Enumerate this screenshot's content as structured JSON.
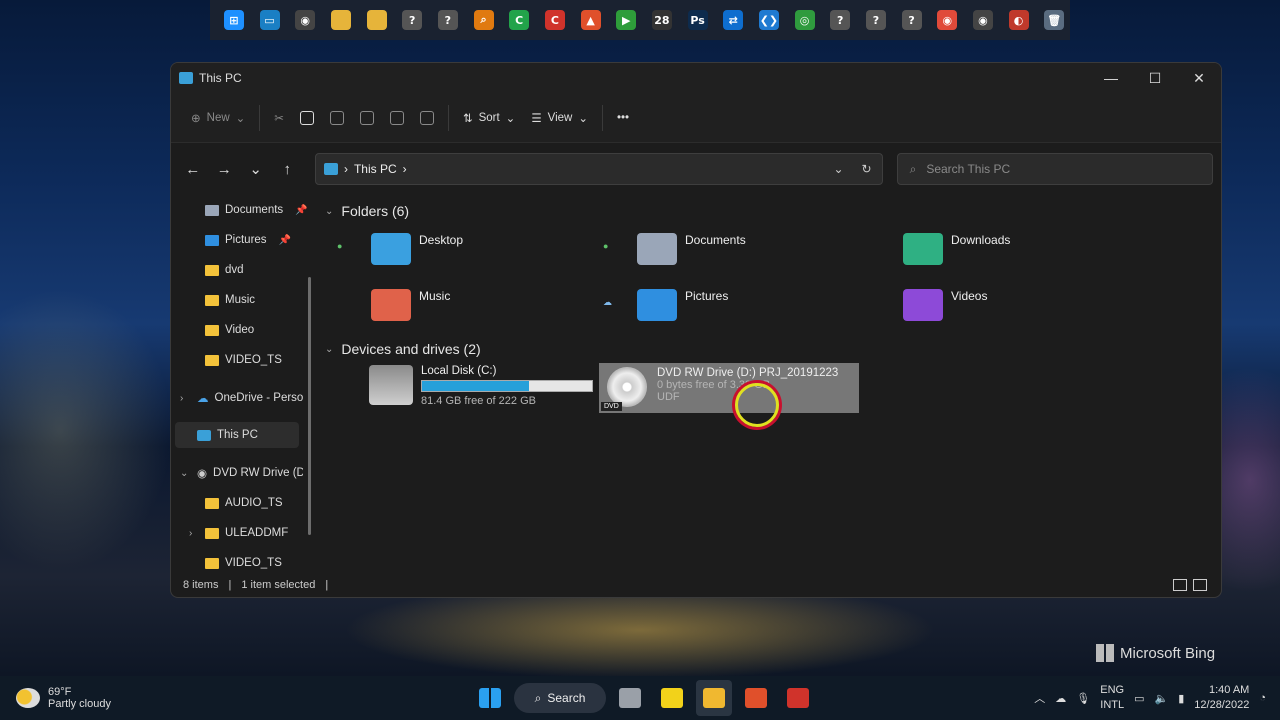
{
  "quick_launch": {
    "icons": [
      {
        "name": "windows-icon",
        "color": "#1e90ff",
        "glyph": "⊞"
      },
      {
        "name": "monitor-icon",
        "color": "#1a7fc4",
        "glyph": "▭"
      },
      {
        "name": "disc-app-icon",
        "color": "#444",
        "glyph": "◉"
      },
      {
        "name": "folder-icon",
        "color": "#e6b43a",
        "glyph": ""
      },
      {
        "name": "folder-icon",
        "color": "#e6b43a",
        "glyph": ""
      },
      {
        "name": "help-icon",
        "color": "#555",
        "glyph": "?"
      },
      {
        "name": "help-icon",
        "color": "#555",
        "glyph": "?"
      },
      {
        "name": "search-app-icon",
        "color": "#e07a10",
        "glyph": "⌕"
      },
      {
        "name": "camtasia-green-icon",
        "color": "#22a34a",
        "glyph": "C"
      },
      {
        "name": "camtasia-red-icon",
        "color": "#d0332b",
        "glyph": "C"
      },
      {
        "name": "brave-icon",
        "color": "#e0502b",
        "glyph": "▲"
      },
      {
        "name": "video-editor-icon",
        "color": "#2e9d3a",
        "glyph": "▶"
      },
      {
        "name": "calendar-icon",
        "color": "#333",
        "glyph": "28"
      },
      {
        "name": "photoshop-icon",
        "color": "#0d2b4d",
        "glyph": "Ps"
      },
      {
        "name": "teamviewer-icon",
        "color": "#0e6ecf",
        "glyph": "⇄"
      },
      {
        "name": "vscode-icon",
        "color": "#1f7ad1",
        "glyph": "❮❯"
      },
      {
        "name": "network-icon",
        "color": "#2f9b3e",
        "glyph": "◎"
      },
      {
        "name": "help-icon",
        "color": "#555",
        "glyph": "?"
      },
      {
        "name": "help-icon",
        "color": "#555",
        "glyph": "?"
      },
      {
        "name": "help-icon",
        "color": "#555",
        "glyph": "?"
      },
      {
        "name": "chrome-icon",
        "color": "#e04a3a",
        "glyph": "◉"
      },
      {
        "name": "disc-app-icon",
        "color": "#444",
        "glyph": "◉"
      },
      {
        "name": "burner-icon",
        "color": "#c0392b",
        "glyph": "◐"
      },
      {
        "name": "recycle-bin-icon",
        "color": "#5a6c80",
        "glyph": "🗑"
      }
    ]
  },
  "window": {
    "title": "This PC",
    "minimize": "—",
    "maximize": "☐",
    "close": "✕"
  },
  "toolbar": {
    "new": "New",
    "sort": "Sort",
    "view": "View",
    "more": "•••"
  },
  "address": {
    "location": "This PC",
    "separator": "›"
  },
  "search": {
    "placeholder": "Search This PC"
  },
  "sidebar": {
    "items": [
      {
        "label": "Documents",
        "pinned": true
      },
      {
        "label": "Pictures",
        "pinned": true
      },
      {
        "label": "dvd"
      },
      {
        "label": "Music"
      },
      {
        "label": "Video"
      },
      {
        "label": "VIDEO_TS"
      },
      {
        "label": "OneDrive - Perso"
      },
      {
        "label": "This PC"
      },
      {
        "label": "DVD RW Drive (D"
      },
      {
        "label": "AUDIO_TS"
      },
      {
        "label": "ULEADDMF"
      },
      {
        "label": "VIDEO_TS"
      }
    ]
  },
  "folders": {
    "header": "Folders (6)",
    "items": [
      {
        "label": "Desktop",
        "color": "#3aa0e0"
      },
      {
        "label": "Documents",
        "color": "#9aa6b8"
      },
      {
        "label": "Downloads",
        "color": "#2fb083"
      },
      {
        "label": "Music",
        "color": "#e0624a"
      },
      {
        "label": "Pictures",
        "color": "#2f8fe0"
      },
      {
        "label": "Videos",
        "color": "#8d4ad8"
      }
    ]
  },
  "drives": {
    "header": "Devices and drives (2)",
    "items": [
      {
        "label": "Local Disk (C:)",
        "free": "81.4 GB free of 222 GB",
        "used_fraction": 0.63
      },
      {
        "label": "DVD RW Drive (D:) PRJ_20191223",
        "free": "0 bytes free of 3.39 GB",
        "fs": "UDF",
        "badge": "DVD"
      }
    ]
  },
  "statusbar": {
    "count": "8 items",
    "selected": "1 item selected",
    "divider": "|"
  },
  "watermark": {
    "text": "Microsoft Bing"
  },
  "taskbar": {
    "search": "Search",
    "weather_temp": "69°F",
    "weather_desc": "Partly cloudy",
    "lang1": "ENG",
    "lang2": "INTL",
    "time": "1:40 AM",
    "date": "12/28/2022"
  }
}
